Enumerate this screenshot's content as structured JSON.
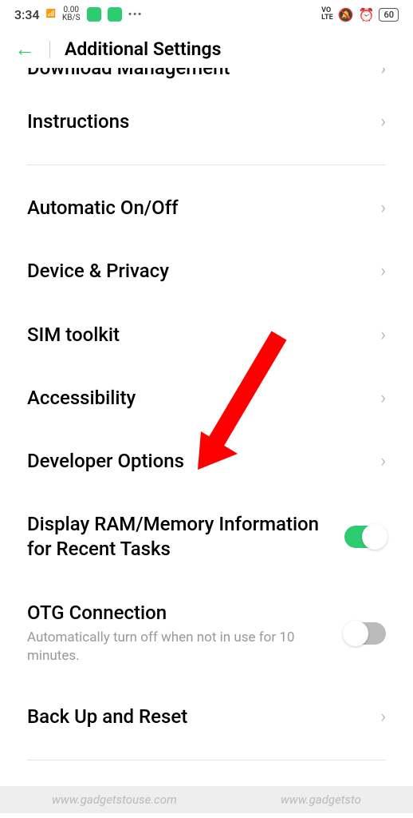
{
  "status_bar": {
    "time": "3:34",
    "signal": "4G",
    "kbs_top": "0.00",
    "kbs_bottom": "KB/S",
    "volte": "VO\nLTE",
    "battery": "60"
  },
  "header": {
    "title": "Additional Settings"
  },
  "items": {
    "partial": "Download Management",
    "instructions": "Instructions",
    "auto_onoff": "Automatic On/Off",
    "device_privacy": "Device & Privacy",
    "sim_toolkit": "SIM toolkit",
    "accessibility": "Accessibility",
    "developer_options": "Developer Options",
    "display_ram": "Display RAM/Memory Information for Recent Tasks",
    "otg": "OTG Connection",
    "otg_sub": "Automatically turn off when not in use for 10 minutes.",
    "backup": "Back Up and Reset"
  },
  "watermark": {
    "left": "www.gadgetstouse.com",
    "right": "www.gadgetsto"
  }
}
